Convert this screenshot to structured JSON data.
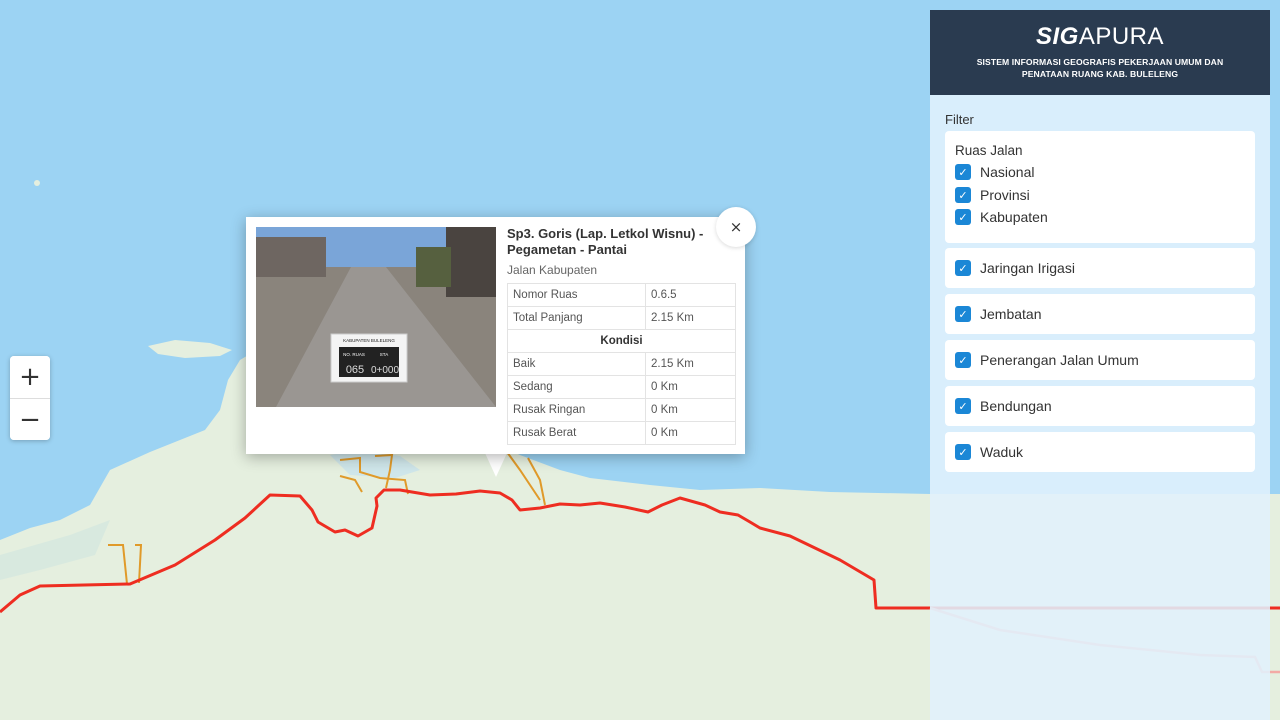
{
  "map": {
    "colors": {
      "sea": "#9cd3f3",
      "land": "#e5efdf",
      "national_road": "#ee2d21",
      "district_road": "#e09a2a"
    }
  },
  "zoom": {
    "in_label": "+",
    "out_label": "−"
  },
  "popup": {
    "close_label": "×",
    "title": "Sp3. Goris (Lap. Letkol Wisnu) - Pegametan - Pantai",
    "subtitle": "Jalan Kabupaten",
    "rows": [
      {
        "key": "Nomor Ruas",
        "value": "0.6.5"
      },
      {
        "key": "Total Panjang",
        "value": "2.15 Km"
      }
    ],
    "condition_header": "Kondisi",
    "conditions": [
      {
        "key": "Baik",
        "value": "2.15 Km"
      },
      {
        "key": "Sedang",
        "value": "0 Km"
      },
      {
        "key": "Rusak Ringan",
        "value": "0 Km"
      },
      {
        "key": "Rusak Berat",
        "value": "0 Km"
      }
    ],
    "photo_sign": {
      "header": "KABUPATEN BULELENG",
      "col1": "NO. RUAS",
      "col2": "STA",
      "num": "065",
      "sta": "0+000"
    }
  },
  "sidebar": {
    "brand_bold": "SIG",
    "brand_rest": "APURA",
    "tagline": "SISTEM INFORMASI GEOGRAFIS PEKERJAAN UMUM DAN PENATAAN RUANG KAB. BULELENG",
    "filter_label": "Filter",
    "ruas_title": "Ruas Jalan",
    "ruas_items": [
      {
        "label": "Nasional",
        "checked": true
      },
      {
        "label": "Provinsi",
        "checked": true
      },
      {
        "label": "Kabupaten",
        "checked": true
      }
    ],
    "layers": [
      {
        "label": "Jaringan Irigasi",
        "checked": true
      },
      {
        "label": "Jembatan",
        "checked": true
      },
      {
        "label": "Penerangan Jalan Umum",
        "checked": true
      },
      {
        "label": "Bendungan",
        "checked": true
      },
      {
        "label": "Waduk",
        "checked": true
      }
    ],
    "check_glyph": "✓",
    "accent": "#1b87d6",
    "header_bg": "#2a3b50"
  }
}
